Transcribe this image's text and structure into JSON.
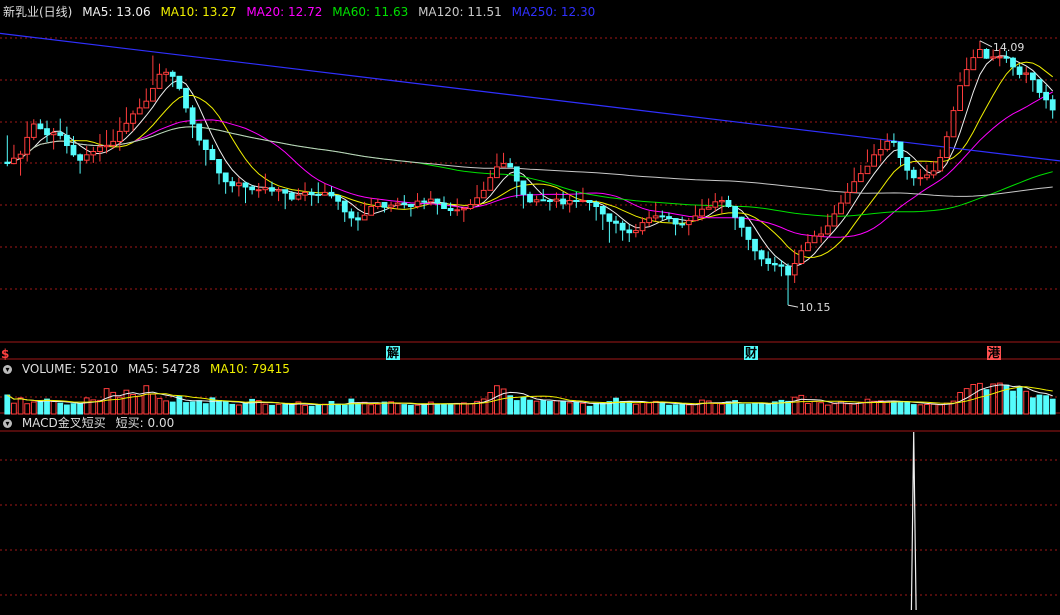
{
  "header": {
    "stock_name": "新乳业(日线)",
    "ma5_text": "MA5: 13.06",
    "ma10_text": "MA10: 13.27",
    "ma20_text": "MA20: 12.72",
    "ma60_text": "MA60: 11.63",
    "ma120_text": "MA120: 11.51",
    "ma250_text": "MA250: 12.30"
  },
  "volume_header": {
    "label": "VOLUME: 52010",
    "ma5_text": "MA5: 54728",
    "ma10_text": "MA10: 79415"
  },
  "indicator_header": {
    "label": "MACD金叉短买",
    "value_text": "短买: 0.00"
  },
  "event_markers": {
    "left": "$",
    "unlock": "解",
    "finance": "财",
    "hk": "港"
  },
  "colors": {
    "up": "#ff3c3c",
    "down": "#54fcfc",
    "ma5": "#f0f0f0",
    "ma10": "#f0f000",
    "ma20": "#ff00ff",
    "ma60": "#00e000",
    "ma120": "#c8c8c8",
    "ma250": "#3030ff",
    "grid": "#a01818"
  },
  "chart_data": {
    "type": "candlestick",
    "title": "新乳业(日线)",
    "ylim": [
      9.6,
      14.4
    ],
    "annotations": {
      "high": "14.09",
      "low": "10.15"
    },
    "candles": [
      [
        12.28,
        12.26,
        12.68,
        12.22
      ],
      [
        12.26,
        12.34,
        12.54,
        12.25
      ],
      [
        12.34,
        12.4,
        12.45,
        12.08
      ],
      [
        12.4,
        12.65,
        12.89,
        12.29
      ],
      [
        12.65,
        12.85,
        12.92,
        12.61
      ],
      [
        12.85,
        12.78,
        12.92,
        12.77
      ],
      [
        12.78,
        12.69,
        12.9,
        12.58
      ],
      [
        12.69,
        12.72,
        12.79,
        12.47
      ],
      [
        12.72,
        12.68,
        12.93,
        12.62
      ],
      [
        12.68,
        12.53,
        12.81,
        12.41
      ],
      [
        12.53,
        12.39,
        12.67,
        12.36
      ],
      [
        12.39,
        12.31,
        12.41,
        12.11
      ],
      [
        12.31,
        12.39,
        12.52,
        12.26
      ],
      [
        12.39,
        12.44,
        12.51,
        12.27
      ],
      [
        12.44,
        12.51,
        12.7,
        12.29
      ],
      [
        12.51,
        12.53,
        12.76,
        12.41
      ],
      [
        12.53,
        12.59,
        12.77,
        12.48
      ],
      [
        12.59,
        12.74,
        12.95,
        12.45
      ],
      [
        12.74,
        12.86,
        13.1,
        12.7
      ],
      [
        12.86,
        13.0,
        13.05,
        12.74
      ],
      [
        13.0,
        13.09,
        13.23,
        13.09
      ],
      [
        13.09,
        13.19,
        13.38,
        13.15
      ],
      [
        13.19,
        13.38,
        13.87,
        13.43
      ],
      [
        13.38,
        13.59,
        13.75,
        13.45
      ],
      [
        13.59,
        13.62,
        13.68,
        13.48
      ],
      [
        13.62,
        13.56,
        13.65,
        13.4
      ],
      [
        13.56,
        13.38,
        13.51,
        13.35
      ],
      [
        13.38,
        13.09,
        13.28,
        13.02
      ],
      [
        13.09,
        12.85,
        13.13,
        12.64
      ],
      [
        12.85,
        12.61,
        12.77,
        12.53
      ],
      [
        12.61,
        12.47,
        12.54,
        12.23
      ],
      [
        12.47,
        12.32,
        12.54,
        12.35
      ],
      [
        12.32,
        12.12,
        12.24,
        11.95
      ],
      [
        12.12,
        11.99,
        12.08,
        11.81
      ],
      [
        11.99,
        11.93,
        12.06,
        11.83
      ],
      [
        11.93,
        11.97,
        12.05,
        11.77
      ],
      [
        11.97,
        11.91,
        11.99,
        11.67
      ],
      [
        11.91,
        11.87,
        11.94,
        11.8
      ],
      [
        11.87,
        11.87,
        11.97,
        11.75
      ],
      [
        11.87,
        11.9,
        12.11,
        11.81
      ],
      [
        11.9,
        11.85,
        11.99,
        11.78
      ],
      [
        11.85,
        11.87,
        11.91,
        11.7
      ],
      [
        11.87,
        11.82,
        11.83,
        11.58
      ],
      [
        11.82,
        11.73,
        11.85,
        11.7
      ],
      [
        11.73,
        11.79,
        11.89,
        11.71
      ],
      [
        11.79,
        11.83,
        11.98,
        11.7
      ],
      [
        11.83,
        11.8,
        11.89,
        11.63
      ],
      [
        11.8,
        11.79,
        11.98,
        11.67
      ],
      [
        11.79,
        11.83,
        11.96,
        11.78
      ],
      [
        11.83,
        11.78,
        11.92,
        11.74
      ],
      [
        11.78,
        11.7,
        11.79,
        11.57
      ],
      [
        11.7,
        11.54,
        11.62,
        11.39
      ],
      [
        11.54,
        11.45,
        11.59,
        11.32
      ],
      [
        11.45,
        11.42,
        11.54,
        11.26
      ],
      [
        11.42,
        11.49,
        11.69,
        11.45
      ],
      [
        11.49,
        11.62,
        11.75,
        11.57
      ],
      [
        11.62,
        11.68,
        11.74,
        11.58
      ],
      [
        11.68,
        11.61,
        11.67,
        11.53
      ],
      [
        11.61,
        11.64,
        11.69,
        11.54
      ],
      [
        11.64,
        11.67,
        11.75,
        11.58
      ],
      [
        11.67,
        11.65,
        11.79,
        11.59
      ],
      [
        11.65,
        11.62,
        11.66,
        11.47
      ],
      [
        11.62,
        11.7,
        11.82,
        11.59
      ],
      [
        11.7,
        11.69,
        11.75,
        11.58
      ],
      [
        11.69,
        11.73,
        11.85,
        11.65
      ],
      [
        11.73,
        11.67,
        11.74,
        11.5
      ],
      [
        11.67,
        11.59,
        11.77,
        11.59
      ],
      [
        11.59,
        11.56,
        11.68,
        11.48
      ],
      [
        11.56,
        11.57,
        11.74,
        11.48
      ],
      [
        11.57,
        11.59,
        11.62,
        11.39
      ],
      [
        11.59,
        11.65,
        11.73,
        11.57
      ],
      [
        11.65,
        11.75,
        11.94,
        11.64
      ],
      [
        11.75,
        11.86,
        11.99,
        11.75
      ],
      [
        11.86,
        12.05,
        12.16,
        11.98
      ],
      [
        12.05,
        12.21,
        12.41,
        12.22
      ],
      [
        12.21,
        12.26,
        12.42,
        12.21
      ],
      [
        12.26,
        12.21,
        12.34,
        12.23
      ],
      [
        12.21,
        12.0,
        12.11,
        11.75
      ],
      [
        12.0,
        11.8,
        11.97,
        11.59
      ],
      [
        11.8,
        11.69,
        11.84,
        11.67
      ],
      [
        11.69,
        11.72,
        11.78,
        11.63
      ],
      [
        11.72,
        11.71,
        11.88,
        11.71
      ],
      [
        11.71,
        11.7,
        11.74,
        11.56
      ],
      [
        11.7,
        11.73,
        11.83,
        11.6
      ],
      [
        11.73,
        11.66,
        11.84,
        11.58
      ],
      [
        11.66,
        11.71,
        11.79,
        11.53
      ],
      [
        11.71,
        11.7,
        11.84,
        11.6
      ],
      [
        11.7,
        11.71,
        11.9,
        11.68
      ],
      [
        11.71,
        11.68,
        11.7,
        11.56
      ],
      [
        11.68,
        11.62,
        11.71,
        11.41
      ],
      [
        11.62,
        11.51,
        11.61,
        11.27
      ],
      [
        11.51,
        11.4,
        11.49,
        11.08
      ],
      [
        11.4,
        11.37,
        11.48,
        11.22
      ],
      [
        11.37,
        11.27,
        11.41,
        11.11
      ],
      [
        11.27,
        11.23,
        11.35,
        11.09
      ],
      [
        11.23,
        11.26,
        11.36,
        11.16
      ],
      [
        11.26,
        11.38,
        11.46,
        11.2
      ],
      [
        11.38,
        11.45,
        11.55,
        11.32
      ],
      [
        11.45,
        11.48,
        11.68,
        11.4
      ],
      [
        11.48,
        11.47,
        11.56,
        11.42
      ],
      [
        11.47,
        11.44,
        11.53,
        11.39
      ],
      [
        11.44,
        11.36,
        11.38,
        11.19
      ],
      [
        11.36,
        11.35,
        11.47,
        11.3
      ],
      [
        11.35,
        11.41,
        11.45,
        11.19
      ],
      [
        11.41,
        11.48,
        11.64,
        11.41
      ],
      [
        11.48,
        11.58,
        11.73,
        11.41
      ],
      [
        11.58,
        11.61,
        11.74,
        11.59
      ],
      [
        11.61,
        11.69,
        11.82,
        11.54
      ],
      [
        11.69,
        11.71,
        11.77,
        11.52
      ],
      [
        11.71,
        11.62,
        11.78,
        11.6
      ],
      [
        11.62,
        11.46,
        11.53,
        11.27
      ],
      [
        11.46,
        11.31,
        11.47,
        11.17
      ],
      [
        11.31,
        11.13,
        11.21,
        10.97
      ],
      [
        11.13,
        10.96,
        11.05,
        10.82
      ],
      [
        10.96,
        10.84,
        10.98,
        10.73
      ],
      [
        10.84,
        10.77,
        10.95,
        10.66
      ],
      [
        10.77,
        10.75,
        10.87,
        10.65
      ],
      [
        10.75,
        10.73,
        10.82,
        10.58
      ],
      [
        10.73,
        10.6,
        10.77,
        10.15
      ],
      [
        10.6,
        10.77,
        10.98,
        10.48
      ],
      [
        10.77,
        10.96,
        11.05,
        10.96
      ],
      [
        10.96,
        11.08,
        11.21,
        11.08
      ],
      [
        11.08,
        11.18,
        11.26,
        11.16
      ],
      [
        11.18,
        11.21,
        11.32,
        11.08
      ],
      [
        11.21,
        11.33,
        11.51,
        11.2
      ],
      [
        11.33,
        11.51,
        11.64,
        11.46
      ],
      [
        11.51,
        11.67,
        11.79,
        11.64
      ],
      [
        11.67,
        11.83,
        11.97,
        11.73
      ],
      [
        11.83,
        11.99,
        12.2,
        11.95
      ],
      [
        11.99,
        12.11,
        12.24,
        12.01
      ],
      [
        12.11,
        12.22,
        12.47,
        12.28
      ],
      [
        12.22,
        12.39,
        12.55,
        12.32
      ],
      [
        12.39,
        12.47,
        12.62,
        12.29
      ],
      [
        12.47,
        12.59,
        12.71,
        12.44
      ],
      [
        12.59,
        12.58,
        12.71,
        12.51
      ],
      [
        12.58,
        12.35,
        12.48,
        12.23
      ],
      [
        12.35,
        12.16,
        12.33,
        12.02
      ],
      [
        12.16,
        12.05,
        12.21,
        11.93
      ],
      [
        12.05,
        12.05,
        12.18,
        11.93
      ],
      [
        12.05,
        12.09,
        12.24,
        12.01
      ],
      [
        12.09,
        12.15,
        12.3,
        12.04
      ],
      [
        12.15,
        12.35,
        12.47,
        12.28
      ],
      [
        12.35,
        12.66,
        12.74,
        12.58
      ],
      [
        12.66,
        13.05,
        13.11,
        12.97
      ],
      [
        13.05,
        13.42,
        13.62,
        13.48
      ],
      [
        13.42,
        13.66,
        13.84,
        13.54
      ],
      [
        13.66,
        13.84,
        13.96,
        13.71
      ],
      [
        13.84,
        13.96,
        14.09,
        13.9
      ],
      [
        13.96,
        13.83,
        13.98,
        13.82
      ],
      [
        13.83,
        13.85,
        13.96,
        13.79
      ],
      [
        13.85,
        13.85,
        13.97,
        13.71
      ],
      [
        13.85,
        13.83,
        13.94,
        13.76
      ],
      [
        13.83,
        13.7,
        13.85,
        13.57
      ],
      [
        13.7,
        13.59,
        13.74,
        13.53
      ],
      [
        13.59,
        13.61,
        13.7,
        13.46
      ],
      [
        13.61,
        13.51,
        13.52,
        13.33
      ],
      [
        13.51,
        13.32,
        13.44,
        13.24
      ],
      [
        13.32,
        13.21,
        13.43,
        13.08
      ],
      [
        13.21,
        13.06,
        13.28,
        12.93
      ]
    ],
    "volume": [
      6.71,
      3.81,
      5.69,
      3.65,
      4.22,
      4.46,
      5.26,
      4.45,
      3.84,
      3.18,
      3.62,
      3.56,
      5.68,
      4.97,
      4.81,
      8.96,
      7.64,
      5.93,
      8.41,
      6.89,
      6.29,
      10.0,
      7.02,
      5.49,
      4.62,
      4.19,
      6.26,
      4.02,
      4.26,
      4.68,
      3.64,
      5.67,
      4.75,
      4.23,
      3.4,
      3.19,
      3.73,
      5.15,
      4.74,
      3.49,
      3.03,
      3.43,
      3.42,
      3.43,
      4.27,
      3.04,
      2.72,
      3.06,
      3.45,
      4.41,
      3.41,
      3.13,
      5.26,
      3.88,
      4.12,
      3.27,
      3.46,
      4.19,
      4.31,
      3.65,
      3.3,
      3.06,
      3.11,
      3.55,
      4.19,
      3.51,
      3.48,
      3.56,
      3.73,
      3.92,
      3.62,
      4.43,
      5.3,
      7.58,
      10.0,
      8.83,
      6.44,
      4.74,
      5.88,
      4.88,
      4.53,
      4.89,
      4.46,
      4.67,
      4.4,
      3.97,
      4.15,
      3.79,
      2.7,
      3.75,
      3.82,
      4.36,
      5.58,
      4.41,
      4.34,
      3.46,
      4.31,
      3.91,
      4.43,
      3.95,
      3.06,
      3.23,
      3.41,
      3.26,
      3.5,
      4.89,
      4.6,
      3.7,
      3.49,
      4.29,
      4.74,
      3.46,
      3.43,
      3.57,
      3.8,
      3.43,
      4.26,
      4.81,
      4.43,
      5.94,
      6.55,
      3.69,
      4.42,
      3.99,
      3.14,
      3.63,
      4.36,
      3.6,
      3.49,
      4.15,
      5.24,
      4.48,
      4.65,
      4.21,
      4.44,
      4.43,
      4.29,
      3.32,
      3.26,
      3.34,
      3.41,
      3.25,
      3.82,
      4.57,
      7.59,
      8.98,
      10.4,
      10.8,
      8.59,
      10.6,
      10.9,
      10.2,
      8.05,
      9.46,
      8.0,
      5.67,
      6.66,
      6.41,
      5.21
    ],
    "volume_ylim": [
      0,
      12
    ],
    "signal": {
      "peak_index": 137,
      "ylim": [
        0,
        1
      ]
    }
  }
}
